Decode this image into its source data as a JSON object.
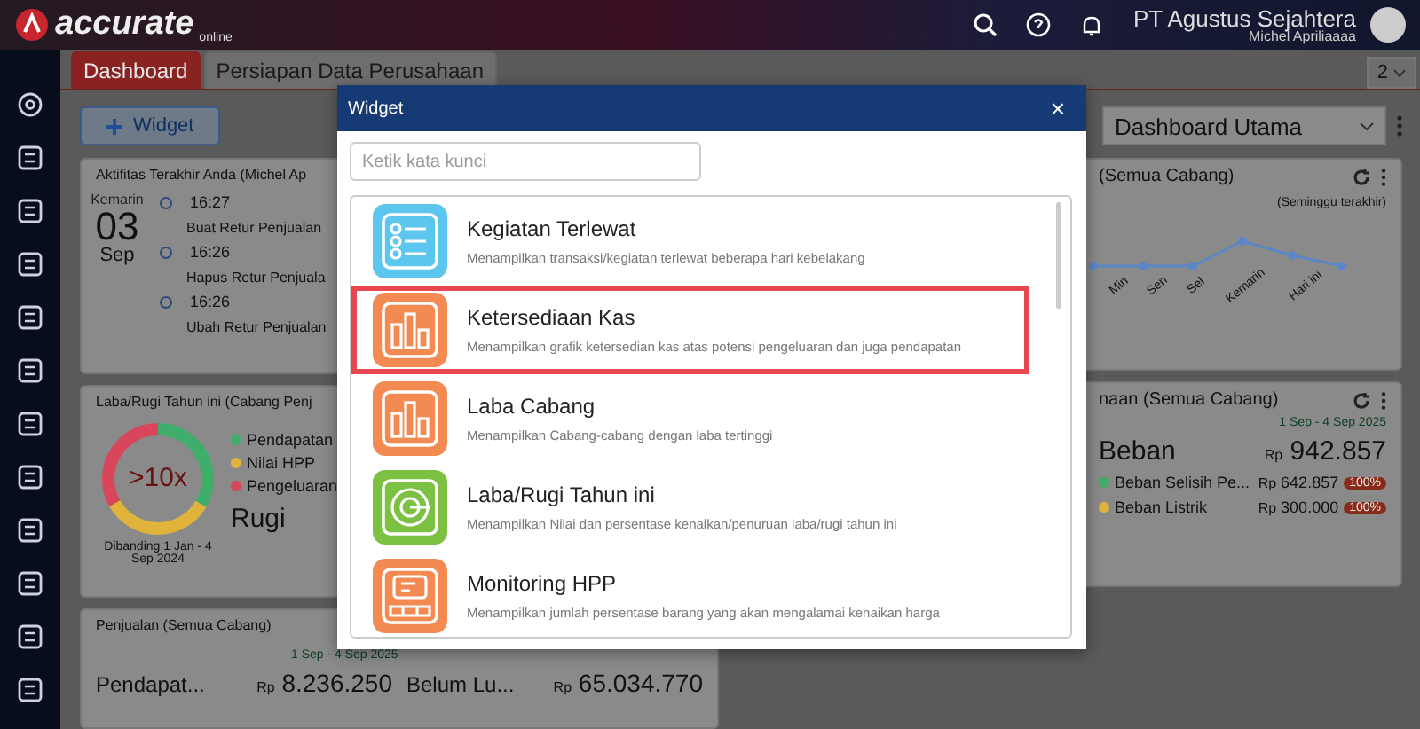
{
  "header": {
    "logo": "accurate",
    "logo_sub": "online",
    "company": "PT Agustus Sejahtera",
    "user": "Michel Apriliaaaa"
  },
  "tabs": [
    {
      "label": "Dashboard",
      "selected": true
    },
    {
      "label": "Persiapan Data Perusahaan",
      "selected": false
    }
  ],
  "page_selector": "2",
  "add_widget_button": "Widget",
  "dashboard_select": "Dashboard Utama",
  "activity": {
    "title": "Aktifitas Terakhir Anda (Michel Ap",
    "day_label": "Kemarin",
    "day": "03",
    "month": "Sep",
    "entries": [
      {
        "time": "16:27",
        "action": "Buat Retur Penjualan"
      },
      {
        "time": "16:26",
        "action": "Hapus Retur Penjuala"
      },
      {
        "time": "16:26",
        "action": "Ubah Retur Penjualan"
      }
    ]
  },
  "profit_loss": {
    "title": "Laba/Rugi Tahun ini (Cabang Penj",
    "ratio": ">10x",
    "legend": [
      {
        "label": "Pendapatan",
        "color": "#3fae6a"
      },
      {
        "label": "Nilai HPP",
        "color": "#e0b43a"
      },
      {
        "label": "Pengeluaran",
        "color": "#d9455b"
      }
    ],
    "result": "Rugi",
    "comparison": "Dibanding 1 Jan - 4 Sep 2024"
  },
  "sales": {
    "title": "Penjualan (Semua Cabang)",
    "period": "1 Sep - 4 Sep 2025",
    "items": [
      {
        "label": "Pendapat...",
        "currency": "Rp",
        "amount": "8.236.250"
      },
      {
        "label": "Belum Lu...",
        "currency": "Rp",
        "amount": "65.034.770"
      }
    ]
  },
  "trend": {
    "title": "(Semua Cabang)",
    "period_note": "(Seminggu terakhir)",
    "x_labels": [
      "Min",
      "Sen",
      "Sel",
      "Kemarin",
      "Hari ini"
    ]
  },
  "expenses": {
    "title": "naan (Semua Cabang)",
    "period": "1 Sep - 4 Sep 2025",
    "total_label": "Beban",
    "currency": "Rp",
    "total": "942.857",
    "rows": [
      {
        "label": "Beban Selisih Pe...",
        "currency": "Rp",
        "amount": "642.857",
        "share": "100%",
        "color": "#3fae6a"
      },
      {
        "label": "Beban Listrik",
        "currency": "Rp",
        "amount": "300.000",
        "share": "100%",
        "color": "#e0b43a"
      }
    ]
  },
  "modal": {
    "title": "Widget",
    "close": "×",
    "search": {
      "placeholder": "Ketik kata kunci"
    },
    "widgets": [
      {
        "kind": "list",
        "title": "Kegiatan Terlewat",
        "description": "Menampilkan transaksi/kegiatan terlewat beberapa hari kebelakang",
        "color": "#5cc6ee",
        "selected": false
      },
      {
        "kind": "bars",
        "title": "Ketersediaan Kas",
        "description": "Menampilkan grafik ketersedian kas atas potensi pengeluaran dan juga pendapatan",
        "color": "#f28a52",
        "selected": true
      },
      {
        "kind": "bars",
        "title": "Laba Cabang",
        "description": "Menampilkan Cabang-cabang dengan laba tertinggi",
        "color": "#f28a52",
        "selected": false
      },
      {
        "kind": "target",
        "title": "Laba/Rugi Tahun ini",
        "description": "Menampilkan Nilai dan persentase kenaikan/penuruan laba/rugi tahun ini",
        "color": "#7cc142",
        "selected": false
      },
      {
        "kind": "monitor",
        "title": "Monitoring HPP",
        "description": "Menampilkan jumlah persentase barang yang akan mengalamai kenaikan harga",
        "color": "#f28a52",
        "selected": false
      }
    ]
  }
}
